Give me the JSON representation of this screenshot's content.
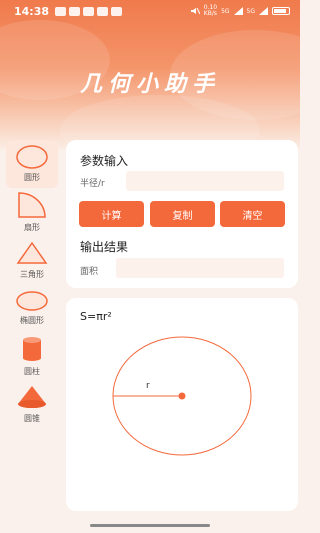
{
  "status_bar": {
    "time": "14:38",
    "net_speed_top": "0.10",
    "net_speed_bottom": "KB/s",
    "signal1": "5G",
    "signal2": "5G"
  },
  "app": {
    "title": "几何小助手"
  },
  "sidebar": {
    "items": [
      {
        "label": "圆形",
        "icon": "circle-icon",
        "active": true
      },
      {
        "label": "扇形",
        "icon": "sector-icon",
        "active": false
      },
      {
        "label": "三角形",
        "icon": "triangle-icon",
        "active": false
      },
      {
        "label": "椭圆形",
        "icon": "ellipse-icon",
        "active": false
      },
      {
        "label": "圆柱",
        "icon": "cylinder-icon",
        "active": false
      },
      {
        "label": "圆锥",
        "icon": "cone-icon",
        "active": false
      }
    ]
  },
  "input_section": {
    "title": "参数输入",
    "radius_label": "半径/r",
    "radius_value": "",
    "radius_placeholder": ""
  },
  "buttons": {
    "calculate": "计算",
    "copy": "复制",
    "clear": "清空"
  },
  "output_section": {
    "title": "输出结果",
    "area_label": "面积",
    "area_value": ""
  },
  "diagram": {
    "formula": "S=πr²",
    "radius_label": "r"
  },
  "colors": {
    "accent": "#f4693b",
    "header_top": "#f07a4c",
    "background": "#fbf1ec",
    "input_bg": "#fdf1ec"
  }
}
